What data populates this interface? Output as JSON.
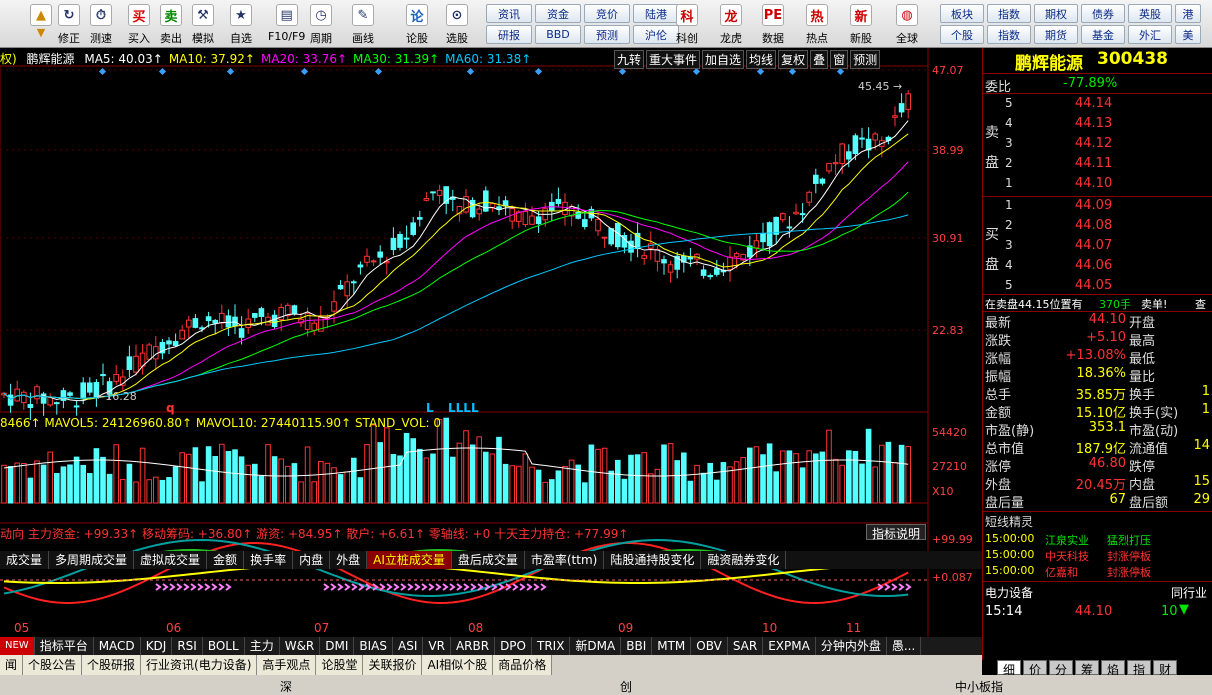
{
  "toolbar": {
    "big": [
      {
        "k": "fix",
        "label": "修正"
      },
      {
        "k": "rec",
        "label": "测速"
      },
      {
        "k": "buy",
        "label": "买入"
      },
      {
        "k": "sell",
        "label": "卖出"
      },
      {
        "k": "sim",
        "label": "模拟"
      },
      {
        "k": "self",
        "label": "自选"
      },
      {
        "k": "f10",
        "label": "F10/F9"
      },
      {
        "k": "cycle",
        "label": "周期"
      },
      {
        "k": "draw",
        "label": "画线"
      },
      {
        "k": "discuss",
        "label": "论股"
      },
      {
        "k": "pick",
        "label": "选股"
      }
    ],
    "mid": [
      [
        "资讯",
        "资金",
        "竞价",
        "陆港"
      ],
      [
        "研报",
        "BBD",
        "预测",
        "沪伦"
      ]
    ],
    "big2": [
      {
        "k": "tech",
        "label": "科创"
      },
      {
        "k": "dragon",
        "label": "龙虎"
      },
      {
        "k": "data",
        "label": "数据"
      },
      {
        "k": "hot",
        "label": "热点"
      },
      {
        "k": "newstock",
        "label": "新股"
      },
      {
        "k": "globe",
        "label": "全球"
      }
    ],
    "right": [
      [
        "板块",
        "指数",
        "期权",
        "债券",
        "英股",
        "港"
      ],
      [
        "个股",
        "指数",
        "期货",
        "基金",
        "外汇",
        "美"
      ]
    ]
  },
  "header": {
    "prefix": "权)",
    "name": "鹏辉能源",
    "ma": [
      {
        "t": "MA5: 40.03↑",
        "c": "#fff"
      },
      {
        "t": "MA10: 37.92↑",
        "c": "#ffff00"
      },
      {
        "t": "MA20: 33.76↑",
        "c": "#ff00ff"
      },
      {
        "t": "MA30: 31.39↑",
        "c": "#00ff00"
      },
      {
        "t": "MA60: 31.38↑",
        "c": "#00c8ff"
      }
    ],
    "btns": [
      "九转",
      "重大事件",
      "加自选",
      "均线",
      "复权",
      "叠",
      "窗",
      "预测"
    ]
  },
  "yaxis": [
    "47.07",
    "38.99",
    "30.91",
    "22.83"
  ],
  "price_marks": {
    "high": "45.45",
    "low": "16.28"
  },
  "letters": [
    {
      "t": "q"
    },
    {
      "t": "L"
    },
    {
      "t": "LLLL"
    }
  ],
  "vol": {
    "title": "8466↑ MAVOL5: 24126960.80↑ MAVOL10: 27440115.90↑ STAND_VOL: 0",
    "axis": [
      "54420",
      "27210",
      "X10"
    ]
  },
  "midtabs": [
    "成交量",
    "多周期成交量",
    "虚拟成交量",
    "金额",
    "换手率",
    "内盘",
    "外盘",
    "AI立桩成交量",
    "盘后成交量",
    "市盈率(ttm)",
    "陆股通持股变化",
    "融资融券变化"
  ],
  "ind": {
    "title": "动向 主力资金: +99.33↑ 移动筹码: +36.80↑ 游资: +84.95↑ 散户: +6.61↑ 零轴线: +0 十天主力持仓: +77.99↑",
    "btn": "指标说明",
    "axis": [
      "+99.99",
      "+0.087"
    ]
  },
  "xaxis": [
    "05",
    "06",
    "07",
    "08",
    "09",
    "10",
    "11"
  ],
  "btabs": [
    "NEW",
    "指标平台",
    "MACD",
    "KDJ",
    "RSI",
    "BOLL",
    "主力",
    "W&R",
    "DMI",
    "BIAS",
    "ASI",
    "VR",
    "ARBR",
    "DPO",
    "TRIX",
    "新DMA",
    "BBI",
    "MTM",
    "OBV",
    "SAR",
    "EXPMA",
    "分钟内外盘",
    "愚..."
  ],
  "btabs2": [
    "闻",
    "个股公告",
    "个股研报",
    "行业资讯(电力设备)",
    "高手观点",
    "论股堂",
    "关联报价",
    "AI相似个股",
    "商品价格"
  ],
  "quote": {
    "name": "鹏辉能源",
    "code": "300438",
    "wei_label": "委比",
    "wei": "-77.89%",
    "sell": [
      [
        "5",
        "44.14"
      ],
      [
        "4",
        "44.13"
      ],
      [
        "3",
        "44.12"
      ],
      [
        "2",
        "44.11"
      ],
      [
        "1",
        "44.10"
      ]
    ],
    "buy": [
      [
        "1",
        "44.09"
      ],
      [
        "2",
        "44.08"
      ],
      [
        "3",
        "44.07"
      ],
      [
        "4",
        "44.06"
      ],
      [
        "5",
        "44.05"
      ]
    ],
    "sellside": "卖盘",
    "buyside": "买盘",
    "notice": "在卖盘44.15位置有",
    "notice_n": "370手",
    "notice_t": "卖单!",
    "notice_c": "查",
    "stats": [
      [
        "最新",
        "44.10",
        "开盘",
        ""
      ],
      [
        "涨跌",
        "+5.10",
        "最高",
        ""
      ],
      [
        "涨幅",
        "+13.08%",
        "最低",
        ""
      ],
      [
        "振幅",
        "18.36%",
        "量比",
        ""
      ],
      [
        "总手",
        "35.85万",
        "换手",
        "1"
      ],
      [
        "金额",
        "15.10亿",
        "换手(实)",
        "1"
      ],
      [
        "市盈(静)",
        "353.1",
        "市盈(动)",
        ""
      ],
      [
        "总市值",
        "187.9亿",
        "流通值",
        "14"
      ],
      [
        "涨停",
        "46.80",
        "跌停",
        ""
      ],
      [
        "外盘",
        "20.45万",
        "内盘",
        "15"
      ],
      [
        "盘后量",
        "67",
        "盘后额",
        "29"
      ]
    ],
    "sprite_title": "短线精灵",
    "sprites": [
      [
        "15:00:00",
        "江泉实业",
        "猛烈打压"
      ],
      [
        "15:00:00",
        "中天科技",
        "封涨停板"
      ],
      [
        "15:00:00",
        "亿嘉和",
        "封涨停板"
      ]
    ],
    "industry": "电力设备",
    "industry_r": "同行业",
    "tick_time": "15:14",
    "tick_price": "44.10",
    "tick_vol": "10",
    "tabs": [
      "细",
      "价",
      "分",
      "筹",
      "焰",
      "指",
      "财"
    ]
  },
  "status": {
    "a": "深",
    "b": "创",
    "c": "中小板指"
  },
  "chart_data": {
    "type": "candlestick",
    "note": "鹏辉能源 300438 daily",
    "ylim": [
      14,
      47.07
    ],
    "x": [
      "05",
      "06",
      "07",
      "08",
      "09",
      "10",
      "11"
    ]
  }
}
